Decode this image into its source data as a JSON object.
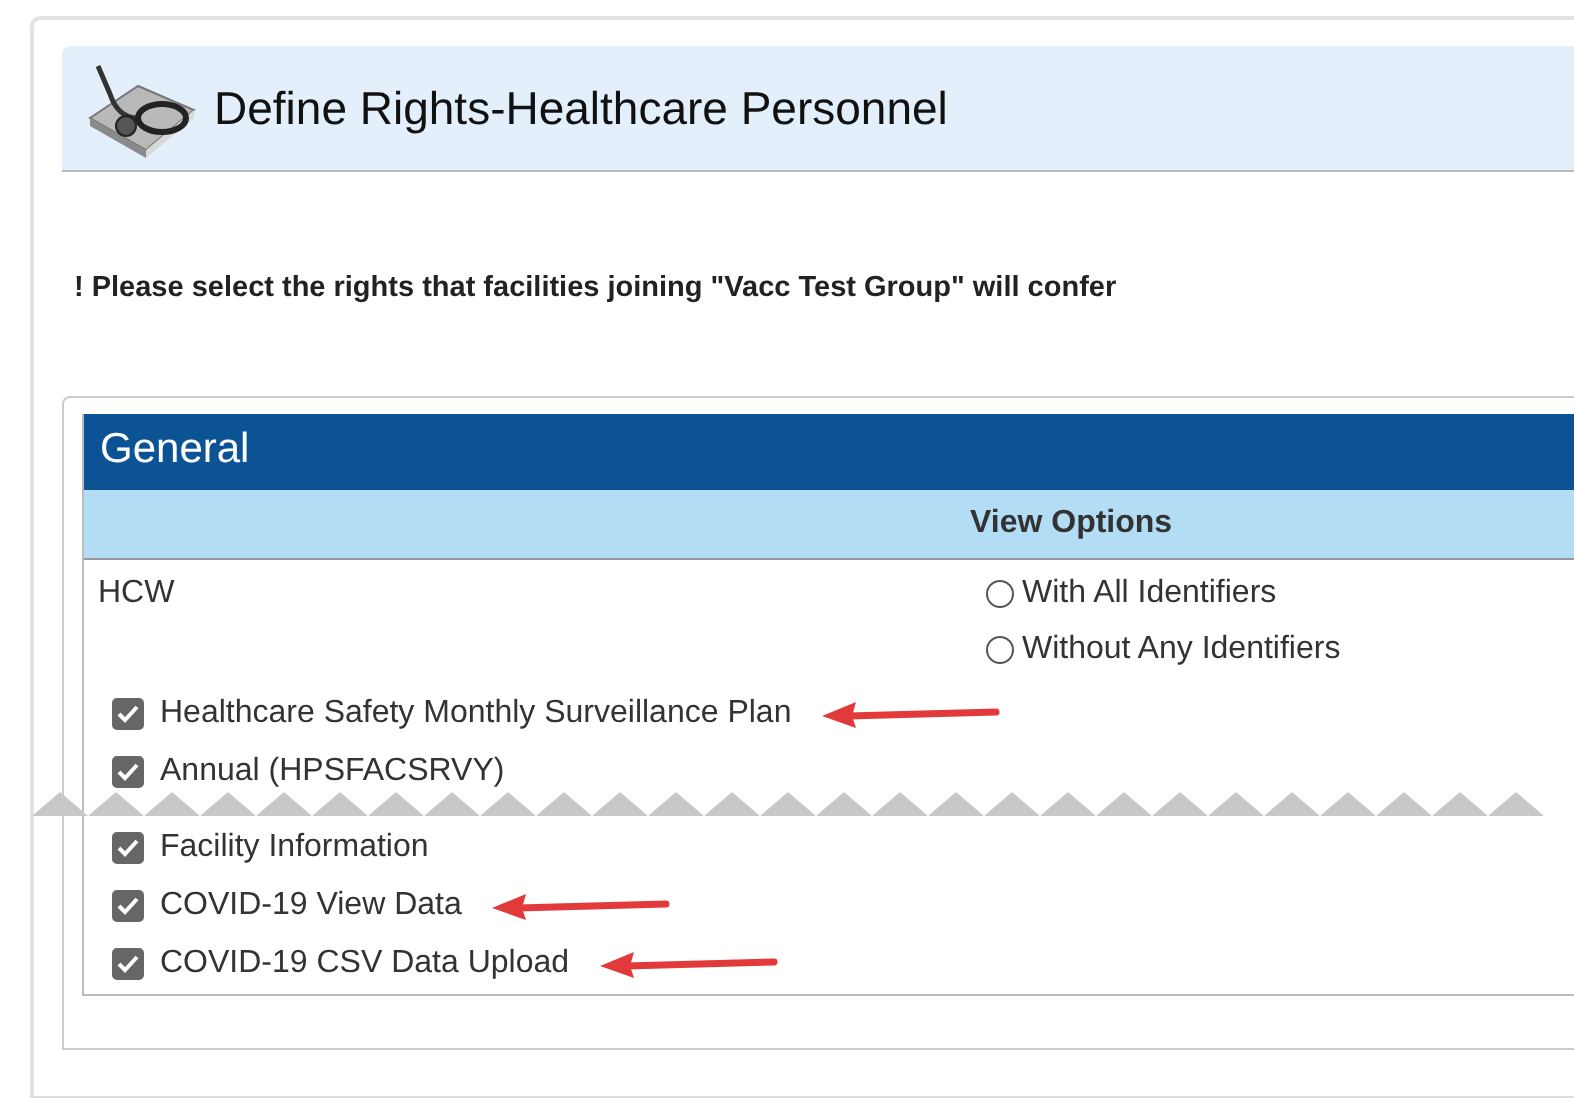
{
  "header": {
    "title": "Define Rights-Healthcare Personnel"
  },
  "instruction": "! Please select the rights that facilities joining \"Vacc Test Group\" will confer",
  "section": {
    "title": "General",
    "column_header": "View Options",
    "row_label": "HCW",
    "view_options": [
      {
        "label": "With All Identifiers",
        "selected": false
      },
      {
        "label": "Without Any Identifiers",
        "selected": false
      }
    ],
    "rights": [
      {
        "label": "Healthcare Safety Monthly Surveillance Plan",
        "checked": true,
        "arrow": true
      },
      {
        "label": "Annual (HPSFACSRVY)",
        "checked": true,
        "arrow": false,
        "torn_after": true
      },
      {
        "label": "Facility Information",
        "checked": true,
        "arrow": false
      },
      {
        "label": "COVID-19 View Data",
        "checked": true,
        "arrow": true
      },
      {
        "label": "COVID-19 CSV Data Upload",
        "checked": true,
        "arrow": true
      }
    ]
  }
}
